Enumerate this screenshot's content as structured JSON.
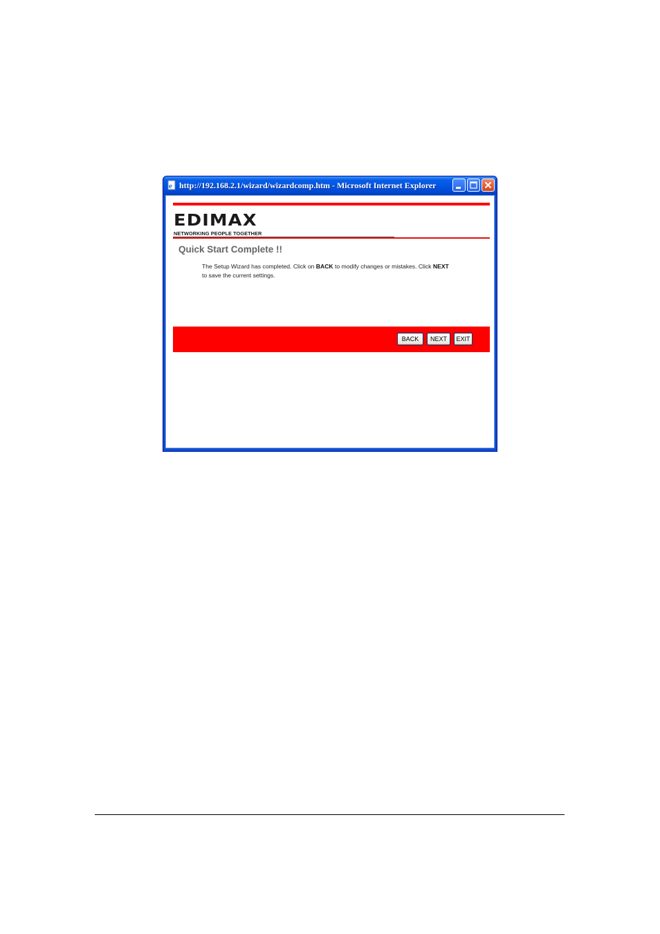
{
  "window": {
    "title": "http://192.168.2.1/wizard/wizardcomp.htm - Microsoft Internet Explorer"
  },
  "logo": {
    "name": "EDIMAX",
    "tagline": "NETWORKING PEOPLE TOGETHER"
  },
  "page": {
    "title": "Quick Start Complete !!",
    "description": {
      "part1": "The Setup Wizard has completed. Click on ",
      "back_word": "BACK",
      "part2": " to modify changes or mistakes. Click ",
      "next_word": "NEXT",
      "part3": " to save the current settings."
    }
  },
  "buttons": {
    "back": "BACK",
    "next": "NEXT",
    "exit": "EXIT"
  },
  "colors": {
    "accent_red": "#ff0000",
    "titlebar_blue": "#0054e3"
  },
  "icons": {
    "window_icon": "ie-page-icon",
    "minimize": "minimize-icon",
    "maximize": "maximize-icon",
    "close": "close-icon"
  }
}
